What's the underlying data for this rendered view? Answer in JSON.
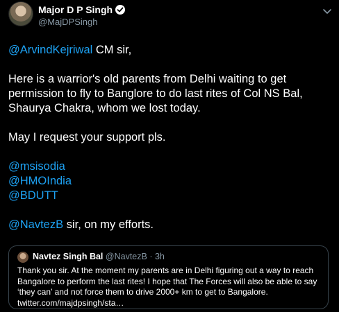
{
  "author": {
    "display_name": "Major D P Singh",
    "handle": "@MajDPSingh",
    "verified": true
  },
  "tweet": {
    "line1_mention": "@ArvindKejriwal",
    "line1_rest": " CM sir,",
    "paragraph2": "Here is a warrior's old parents from Delhi waiting to get permission to fly to Banglore to do last rites of Col NS Bal, Shaurya Chakra, whom we lost today.",
    "paragraph3": "May I request your support pls.",
    "mentions": [
      "@msisodia",
      "@HMOIndia",
      "@BDUTT"
    ],
    "last_mention": "@NavtezB",
    "last_rest": " sir, on my efforts."
  },
  "quoted_tweet": {
    "display_name": "Navtez Singh Bal",
    "handle": "@NavtezB",
    "separator": "·",
    "time": "3h",
    "text": "Thank you sir. At the moment my parents are in Delhi figuring out a way to reach Bangalore to perform the last rites! I hope that The Forces will also be able to say ‘they can’ and not force them to drive 2000+ km to get to Bangalore. twitter.com/majdpsingh/sta…"
  },
  "colors": {
    "background": "#000000",
    "link": "#1da1f2",
    "secondary_text": "#8899a6",
    "border": "#38444d"
  },
  "icons": [
    "verified-badge-icon",
    "chevron-down-icon"
  ]
}
